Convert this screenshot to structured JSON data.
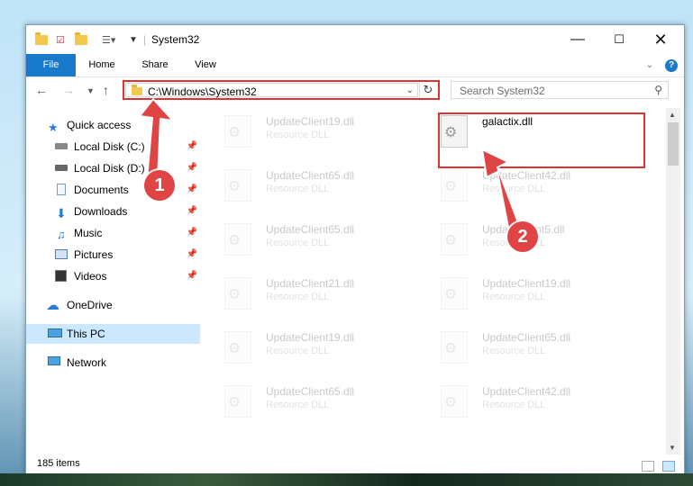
{
  "window": {
    "title": "System32"
  },
  "ribbon": {
    "tabs": [
      "File",
      "Home",
      "Share",
      "View"
    ]
  },
  "address": {
    "path": "C:\\Windows\\System32",
    "search_placeholder": "Search System32"
  },
  "nav_pane": {
    "items": [
      {
        "label": "Quick access",
        "icon": "star-icon"
      },
      {
        "label": "Local Disk (C:)",
        "icon": "drive-icon"
      },
      {
        "label": "Local Disk (D:)",
        "icon": "drive-icon"
      },
      {
        "label": "Documents",
        "icon": "documents-icon"
      },
      {
        "label": "Downloads",
        "icon": "download-icon"
      },
      {
        "label": "Music",
        "icon": "music-icon"
      },
      {
        "label": "Pictures",
        "icon": "pictures-icon"
      },
      {
        "label": "Videos",
        "icon": "videos-icon"
      },
      {
        "label": "OneDrive",
        "icon": "cloud-icon"
      },
      {
        "label": "This PC",
        "icon": "computer-icon"
      },
      {
        "label": "Network",
        "icon": "network-icon"
      }
    ]
  },
  "files": {
    "left": [
      {
        "name": "UpdateClient19.dll",
        "desc": "Resource DLL"
      },
      {
        "name": "UpdateClient65.dll",
        "desc": "Resource DLL"
      },
      {
        "name": "UpdateClient65.dll",
        "desc": "Resource DLL"
      },
      {
        "name": "UpdateClient21.dll",
        "desc": "Resource DLL"
      },
      {
        "name": "UpdateClient19.dll",
        "desc": "Resource DLL"
      },
      {
        "name": "UpdateClient65.dll",
        "desc": "Resource DLL"
      }
    ],
    "right": [
      {
        "name": "galactix.dll",
        "desc": ""
      },
      {
        "name": "UpdateClient42.dll",
        "desc": "Resource DLL"
      },
      {
        "name": "UpdateClient5.dll",
        "desc": "Resource DLL"
      },
      {
        "name": "UpdateClient19.dll",
        "desc": "Resource DLL"
      },
      {
        "name": "UpdateClient65.dll",
        "desc": "Resource DLL"
      },
      {
        "name": "UpdateClient42.dll",
        "desc": "Resource DLL"
      }
    ]
  },
  "status": {
    "items_count": "185 items"
  },
  "callouts": [
    "1",
    "2"
  ],
  "colors": {
    "accent": "#1979ca",
    "highlight": "#dd3333",
    "selection": "#cce8ff"
  }
}
